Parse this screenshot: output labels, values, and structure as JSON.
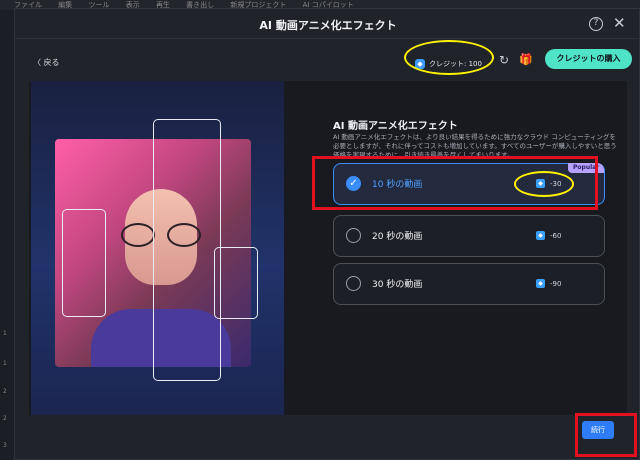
{
  "app": {
    "menubar": [
      "ファイル",
      "編集",
      "ツール",
      "表示",
      "再生",
      "書き出し",
      "新規プロジェクト",
      "AI コパイロット"
    ],
    "side_numbers": [
      "1",
      "1",
      "2",
      "2",
      "3"
    ]
  },
  "dialog": {
    "title": "AI 動画アニメ化エフェクト",
    "help_glyph": "?",
    "close_glyph": "✕"
  },
  "toolbar": {
    "back_label": "〈  戻る",
    "credits_label": "クレジット: 100",
    "buy_label": "クレジットの購入"
  },
  "effect": {
    "title": "AI 動画アニメ化エフェクト",
    "description": "AI 動画アニメ化エフェクトは、より良い結果を得るために強力なクラウド コンピューティングを必要としますが、それに伴ってコストも増加しています。すべてのユーザーが購入しやすいと思う価格を実現するために、引き続き最善を尽くしてまいります。"
  },
  "options": [
    {
      "label": "10 秒の動画",
      "cost": "-30",
      "selected": true,
      "badge": "Popular"
    },
    {
      "label": "20 秒の動画",
      "cost": "-60",
      "selected": false
    },
    {
      "label": "30 秒の動画",
      "cost": "-90",
      "selected": false
    }
  ],
  "actions": {
    "run_label": "続行"
  },
  "colors": {
    "accent": "#3a8dff",
    "buy_button": "#4fe3c8",
    "highlight_yellow": "#fff200",
    "highlight_red": "#e3101f"
  }
}
